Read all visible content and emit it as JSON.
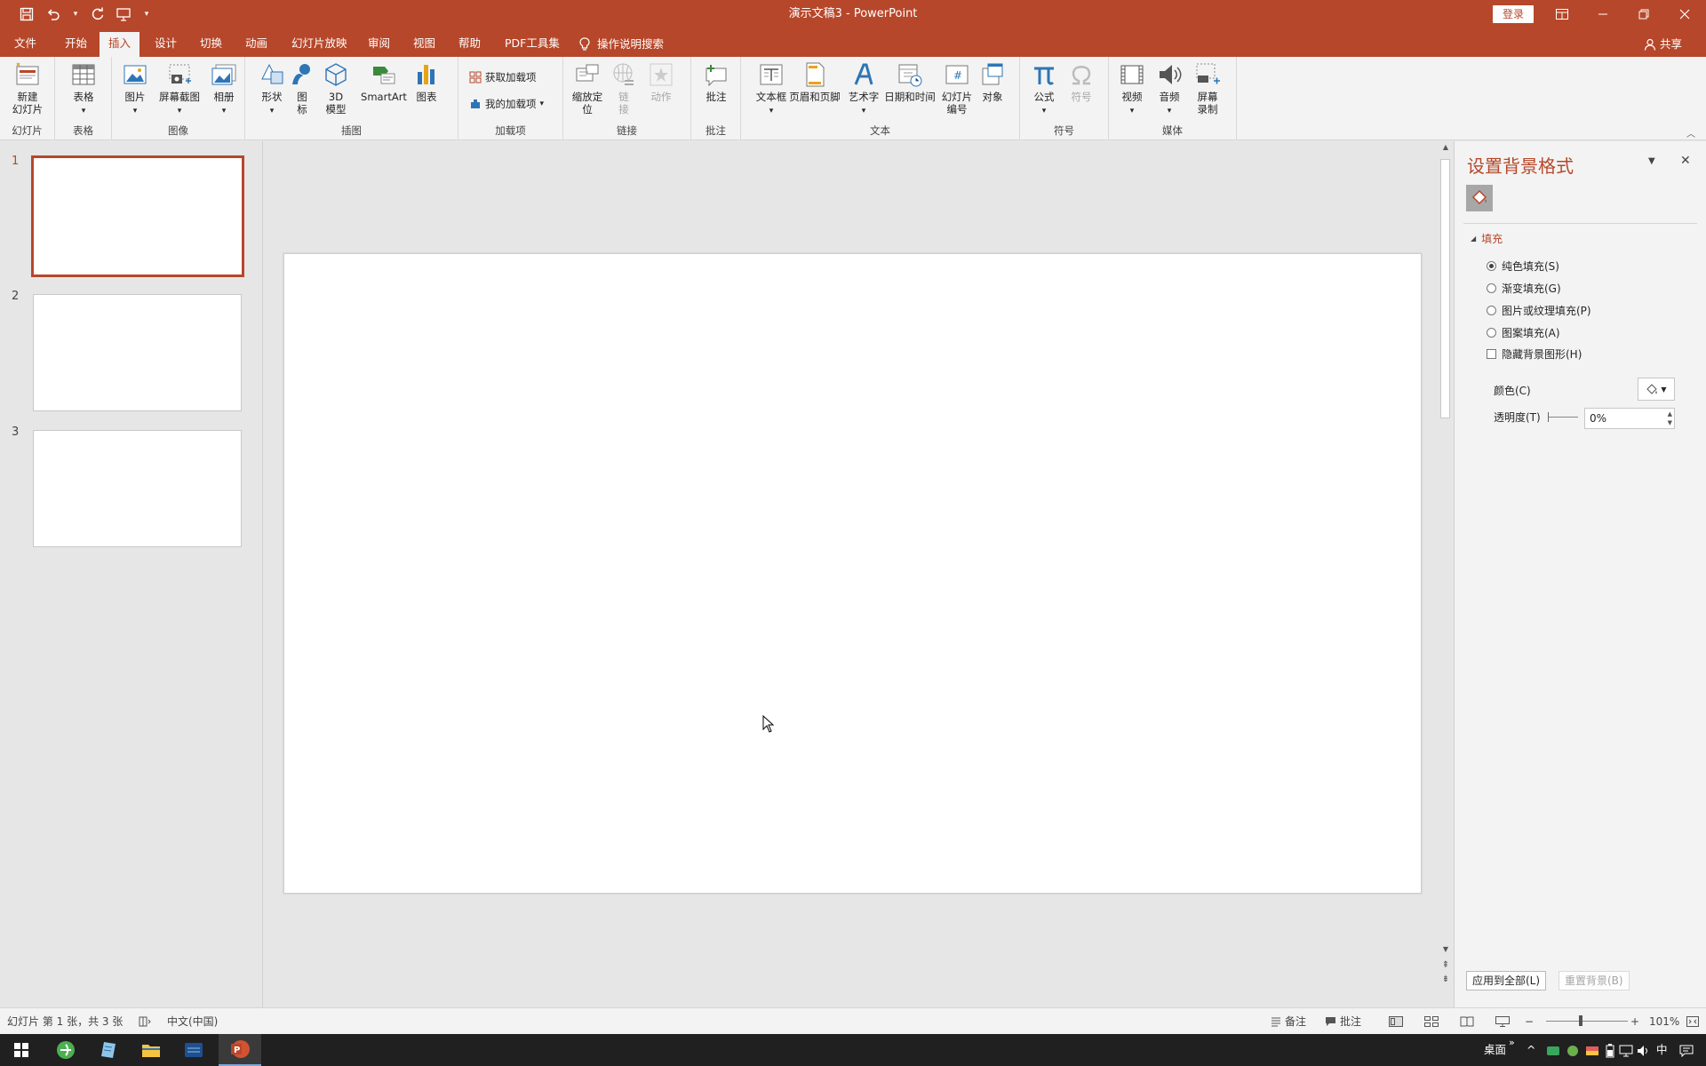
{
  "window": {
    "title": "演示文稿3  -  PowerPoint",
    "signin_label": "登录",
    "qat_icons": [
      "save-icon",
      "undo-icon",
      "redo-icon",
      "present-from-start-icon",
      "customize-qat-icon"
    ]
  },
  "tabs": [
    {
      "label": "文件"
    },
    {
      "label": "开始"
    },
    {
      "label": "插入",
      "active": true
    },
    {
      "label": "设计"
    },
    {
      "label": "切换"
    },
    {
      "label": "动画"
    },
    {
      "label": "幻灯片放映"
    },
    {
      "label": "审阅"
    },
    {
      "label": "视图"
    },
    {
      "label": "帮助"
    },
    {
      "label": "PDF工具集"
    }
  ],
  "tell_me": "操作说明搜索",
  "share": "共享",
  "ribbon": {
    "groups": {
      "slides": "幻灯片",
      "tables": "表格",
      "images": "图像",
      "illustrations": "插图",
      "addins": "加载项",
      "links": "链接",
      "comments": "批注",
      "text": "文本",
      "symbols": "符号",
      "media": "媒体"
    },
    "buttons": {
      "new_slide": "新建\n幻灯片",
      "table": "表格",
      "pictures": "图片",
      "screenshot": "屏幕截图",
      "album": "相册",
      "shapes": "形状",
      "icons": "图\n标",
      "models3d": "3D\n模型",
      "smartart": "SmartArt",
      "chart": "图表",
      "get_addins": "获取加载项",
      "my_addins": "我的加载项",
      "zoom": "缩放定\n位",
      "link": "链\n接",
      "action": "动作",
      "comment": "批注",
      "textbox": "文本框",
      "header_footer": "页眉和页脚",
      "wordart": "艺术字",
      "datetime": "日期和时间",
      "slide_number": "幻灯片\n编号",
      "object": "对象",
      "equation": "公式",
      "symbol": "符号",
      "video": "视频",
      "audio": "音频",
      "screen_record": "屏幕\n录制"
    }
  },
  "thumbnails": [
    {
      "number": "1",
      "selected": true
    },
    {
      "number": "2",
      "selected": false
    },
    {
      "number": "3",
      "selected": false
    }
  ],
  "format_pane": {
    "title": "设置背景格式",
    "section": "填充",
    "options": [
      {
        "label": "纯色填充(S)",
        "type": "radio",
        "checked": true
      },
      {
        "label": "渐变填充(G)",
        "type": "radio",
        "checked": false
      },
      {
        "label": "图片或纹理填充(P)",
        "type": "radio",
        "checked": false
      },
      {
        "label": "图案填充(A)",
        "type": "radio",
        "checked": false
      },
      {
        "label": "隐藏背景图形(H)",
        "type": "checkbox",
        "checked": false
      }
    ],
    "color_label": "颜色(C)",
    "transparency_label": "透明度(T)",
    "transparency_value": "0%",
    "apply_all": "应用到全部(L)",
    "reset": "重置背景(B)"
  },
  "statusbar": {
    "slide_info": "幻灯片 第 1 张，共 3 张",
    "language": "中文(中国)",
    "notes": "备注",
    "comments": "批注",
    "zoom": "101%"
  },
  "taskbar": {
    "desktop": "桌面",
    "ime": "中",
    "chevron": "»"
  },
  "colors": {
    "accent": "#b7472a",
    "ribbon_bg": "#f3f3f3",
    "workspace_bg": "#e6e6e6"
  }
}
